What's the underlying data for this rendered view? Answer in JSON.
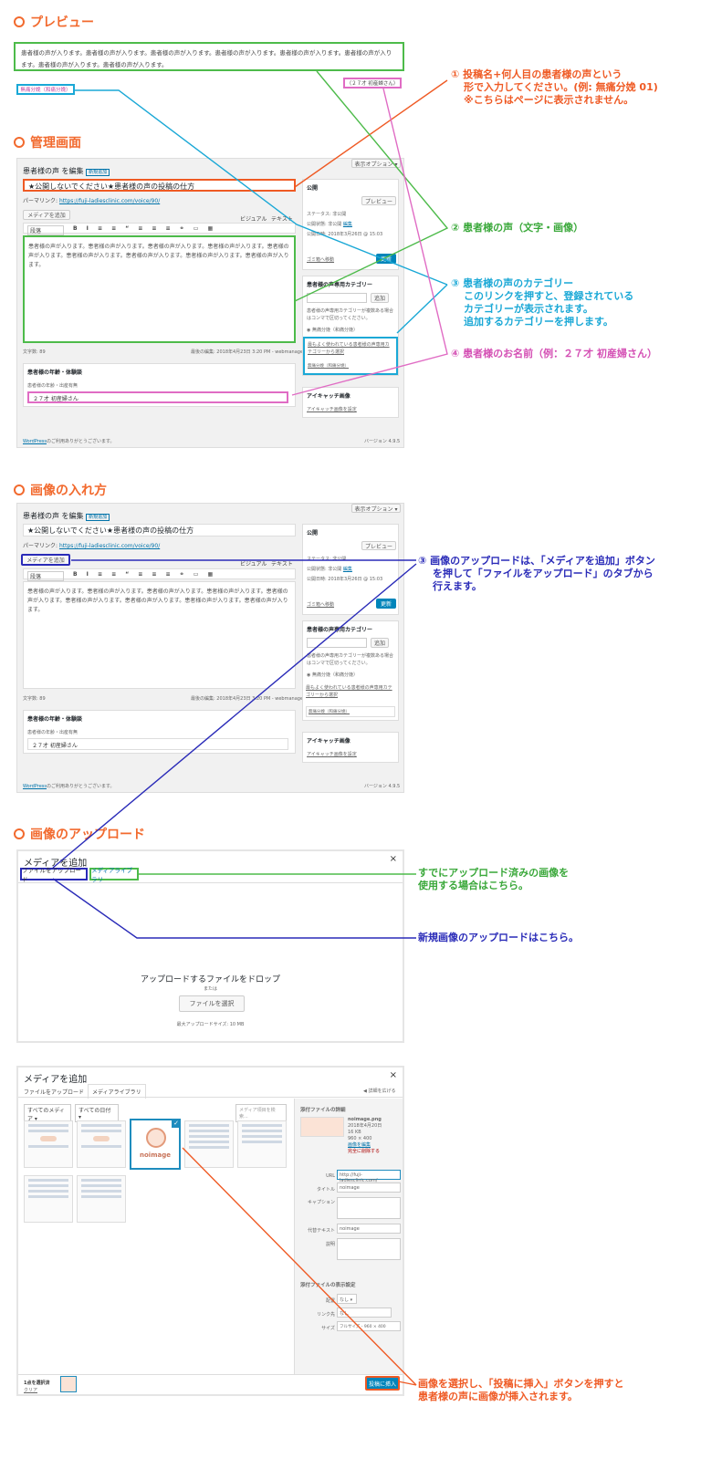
{
  "sections": {
    "preview": "プレビュー",
    "admin": "管理画面",
    "image_insert": "画像の入れ方",
    "image_upload": "画像のアップロード"
  },
  "preview": {
    "body": "患者様の声が入ります。患者様の声が入ります。患者様の声が入ります。患者様の声が入ります。患者様の声が入ります。患者様の声が入ります。患者様の声が入ります。患者様の声が入ります。",
    "category_tag": "無痛分娩（和痛分娩）",
    "name_tag": "（２７才 初産婦さん）"
  },
  "notes": {
    "n1_line1": "① 投稿名+何人目の患者様の声という",
    "n1_line2": "形で入力してください。(例: 無痛分娩 01)",
    "n1_line3": "※こちらはページに表示されません。",
    "n2": "② 患者様の声（文字・画像）",
    "n3_line1": "③ 患者様の声のカテゴリー",
    "n3_line2": "このリンクを押すと、登録されている",
    "n3_line3": "カテゴリーが表示されます。",
    "n3_line4": "追加するカテゴリーを押します。",
    "n4": "④ 患者様のお名前（例：２７才 初産婦さん）",
    "n5_line1": "③ 画像のアップロードは、「メディアを追加」ボタン",
    "n5_line2": "を押して「ファイルをアップロード」のタブから",
    "n5_line3": "行えます。",
    "n6_line1": "すでにアップロード済みの画像を",
    "n6_line2": "使用する場合はこちら。",
    "n7": "新規画像のアップロードはこちら。",
    "n8_line1": "画像を選択し、「投稿に挿入」ボタンを押すと",
    "n8_line2": "患者様の声に画像が挿入されます。"
  },
  "editor": {
    "heading": "患者様の声 を編集",
    "new_badge": "新規追加",
    "screen_options": "表示オプション ▾",
    "title_value": "★公開しないでください★患者様の声の投稿の仕方",
    "permalink_label": "パーマリンク:",
    "permalink_url": "https://fuji-ladiesclinic.com/voice/90/",
    "add_media": "メディアを追加",
    "tab_visual": "ビジュアル",
    "tab_text": "テキスト",
    "format_select": "段落",
    "body": "患者様の声が入ります。患者様の声が入ります。患者様の声が入ります。患者様の声が入ります。患者様の声が入ります。患者様の声が入ります。患者様の声が入ります。患者様の声が入ります。患者様の声が入ります。",
    "word_count": "文字数: 89",
    "last_edit": "最後の編集: 2018年4月23日 3:20 PM - webmanager",
    "box_age_title": "患者様の年齢・体験談",
    "age_label": "患者様の年齢・出産有無",
    "age_value": "２７才 初産婦さん",
    "footer_left_link": "WordPress",
    "footer_left": "のご利用ありがとうございます。",
    "footer_right": "バージョン 4.9.5"
  },
  "publish": {
    "title": "公開",
    "preview_btn": "プレビュー",
    "status": "ステータス: 非公開",
    "visibility": "公開状態: 非公開",
    "edit": "編集",
    "date": "公開日時: 2018年3月26日 @ 15:03",
    "trash": "ゴミ箱へ移動",
    "update": "更新"
  },
  "category_box": {
    "title": "患者様の声専用カテゴリー",
    "add_btn": "追加",
    "help": "患者様の声専用カテゴリーが複数ある場合はコンマで区切ってください。",
    "checked": "無痛分娩（和痛分娩）",
    "popular_link": "最もよく使われている患者様の声専用カテゴリーから選択",
    "tag_item": "無痛分娩（和痛分娩）"
  },
  "eyecatch": {
    "title": "アイキャッチ画像",
    "link": "アイキャッチ画像を設定"
  },
  "upload_modal": {
    "title": "メディアを追加",
    "tab_upload": "ファイルをアップロード",
    "tab_library": "メディアライブラリ",
    "drop_text": "アップロードするファイルをドロップ",
    "or": "または",
    "select_btn": "ファイルを選択",
    "max_size": "最大アップロードサイズ: 10 MB",
    "close": "×"
  },
  "library_modal": {
    "title": "メディアを追加",
    "tab_upload": "ファイルをアップロード",
    "tab_library": "メディアライブラリ",
    "filter_all_media": "すべてのメディア",
    "filter_all_dates": "すべての日付",
    "search_placeholder": "メディア項目を検索...",
    "hide_details": "詳細を広げる",
    "noimage_label": "noimage",
    "details_title": "添付ファイルの詳細",
    "file_name": "noimage.png",
    "file_date": "2018年4月20日",
    "file_size": "16 KB",
    "file_dims": "960 × 400",
    "edit_image": "画像を編集",
    "delete_perm": "完全に削除する",
    "label_url": "URL",
    "url_value": "http://fuji-ladiesclinic.com/",
    "label_title": "タイトル",
    "title_value": "noimage",
    "label_caption": "キャプション",
    "label_alt": "代替テキスト",
    "alt_value": "noimage",
    "label_desc": "説明",
    "display_settings": "添付ファイルの表示設定",
    "label_align": "配置",
    "align_value": "なし",
    "label_link": "リンク先",
    "link_value": "なし",
    "label_size": "サイズ",
    "size_value": "フルサイズ - 960 × 400",
    "selected_count": "1点を選択済",
    "clear": "クリア",
    "insert_btn": "投稿に挿入"
  },
  "colors": {
    "orange": "#ef5a24",
    "green": "#4dbb4a",
    "cyan": "#1aa8d6",
    "pink": "#e06cc4",
    "navy": "#2a2bb8",
    "wp_blue": "#0085ba"
  }
}
